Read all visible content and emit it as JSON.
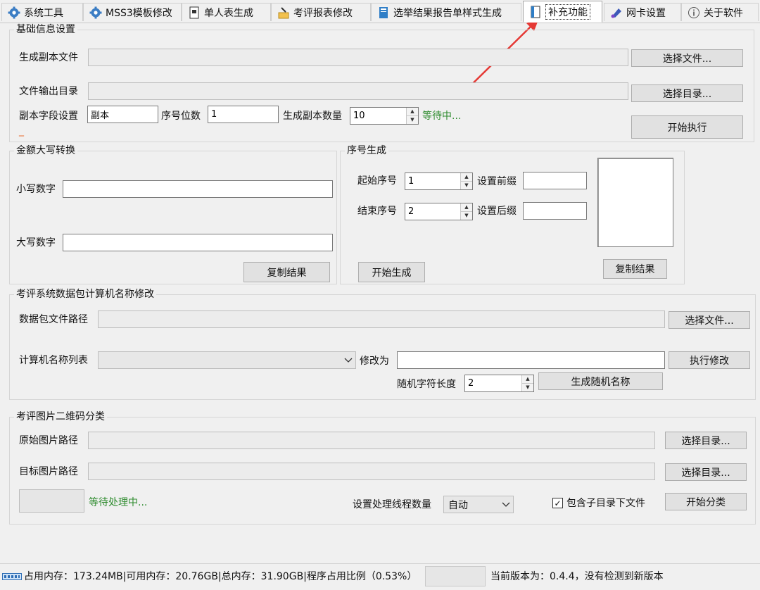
{
  "tabs": [
    {
      "label": "系统工具",
      "icon": "gear-icon"
    },
    {
      "label": "MSS3模板修改",
      "icon": "gear-icon"
    },
    {
      "label": "单人表生成",
      "icon": "document-icon"
    },
    {
      "label": "考评报表修改",
      "icon": "document-edit-icon"
    },
    {
      "label": "选举结果报告单样式生成",
      "icon": "notebook-icon"
    },
    {
      "label": "补充功能",
      "icon": "blank-page-icon",
      "active": true
    },
    {
      "label": "网卡设置",
      "icon": "network-icon"
    },
    {
      "label": "关于软件",
      "icon": "info-icon"
    }
  ],
  "basic": {
    "title": "基础信息设置",
    "copy_file_label": "生成副本文件",
    "copy_file_value": "",
    "select_file_btn": "选择文件...",
    "output_dir_label": "文件输出目录",
    "output_dir_value": "",
    "select_dir_btn": "选择目录...",
    "field_label": "副本字段设置",
    "field_value": "副本",
    "digits_label": "序号位数",
    "digits_value": "1",
    "count_label": "生成副本数量",
    "count_value": "10",
    "status": "等待中...",
    "marker": "_",
    "start_btn": "开始执行"
  },
  "amount": {
    "title": "金额大写转换",
    "lower_label": "小写数字",
    "lower_value": "",
    "upper_label": "大写数字",
    "upper_value": "",
    "copy_btn": "复制结果"
  },
  "serial": {
    "title": "序号生成",
    "start_label": "起始序号",
    "start_value": "1",
    "end_label": "结束序号",
    "end_value": "2",
    "prefix_label": "设置前缀",
    "prefix_value": "",
    "suffix_label": "设置后缀",
    "suffix_value": "",
    "generate_btn": "开始生成",
    "copy_btn": "复制结果"
  },
  "pcname": {
    "title": "考评系统数据包计算机名称修改",
    "path_label": "数据包文件路径",
    "path_value": "",
    "select_file_btn": "选择文件...",
    "list_label": "计算机名称列表",
    "list_value": "",
    "modify_to_label": "修改为",
    "modify_to_value": "",
    "execute_btn": "执行修改",
    "random_len_label": "随机字符长度",
    "random_len_value": "2",
    "random_btn": "生成随机名称"
  },
  "qr": {
    "title": "考评图片二维码分类",
    "src_label": "原始图片路径",
    "src_value": "",
    "src_btn": "选择目录...",
    "dst_label": "目标图片路径",
    "dst_value": "",
    "dst_btn": "选择目录...",
    "status": "等待处理中...",
    "threads_label": "设置处理线程数量",
    "threads_value": "自动",
    "subdir_label": "包含子目录下文件",
    "subdir_checked": true,
    "start_btn": "开始分类"
  },
  "status_bar": {
    "memory": "占用内存：173.24MB|可用内存：20.76GB|总内存：31.90GB|程序占用比例（0.53%）",
    "version": "当前版本为：0.4.4，没有检测到新版本"
  },
  "annotation_color": "#e53935"
}
